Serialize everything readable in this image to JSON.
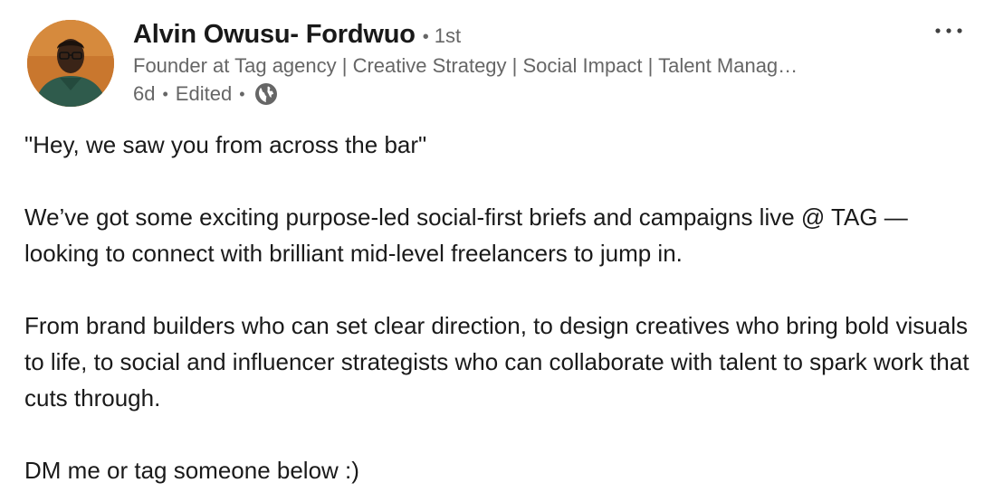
{
  "author": {
    "name": "Alvin Owusu- Fordwuo",
    "connection_degree": "1st",
    "headline": "Founder at Tag agency | Creative Strategy | Social Impact | Talent Manag…",
    "posted_ago": "6d",
    "edited_label": "Edited",
    "visibility_icon": "globe-icon",
    "avatar_background": "#c9772e"
  },
  "menu": {
    "more_icon": "more-horizontal-icon"
  },
  "post": {
    "paragraphs": [
      "\"Hey, we saw you from across the bar\"",
      "We’ve got some exciting purpose-led social-first briefs and campaigns live @ TAG — looking to connect with brilliant mid-level freelancers to jump in.",
      "From brand builders who can set clear direction, to design creatives who bring bold visuals to life, to social and influencer strategists who can collaborate with talent to spark work that cuts through.",
      "DM me or tag someone below :)"
    ]
  },
  "colors": {
    "name_text": "#191919",
    "secondary_text": "#666666",
    "body_text": "#1a1a1a"
  }
}
